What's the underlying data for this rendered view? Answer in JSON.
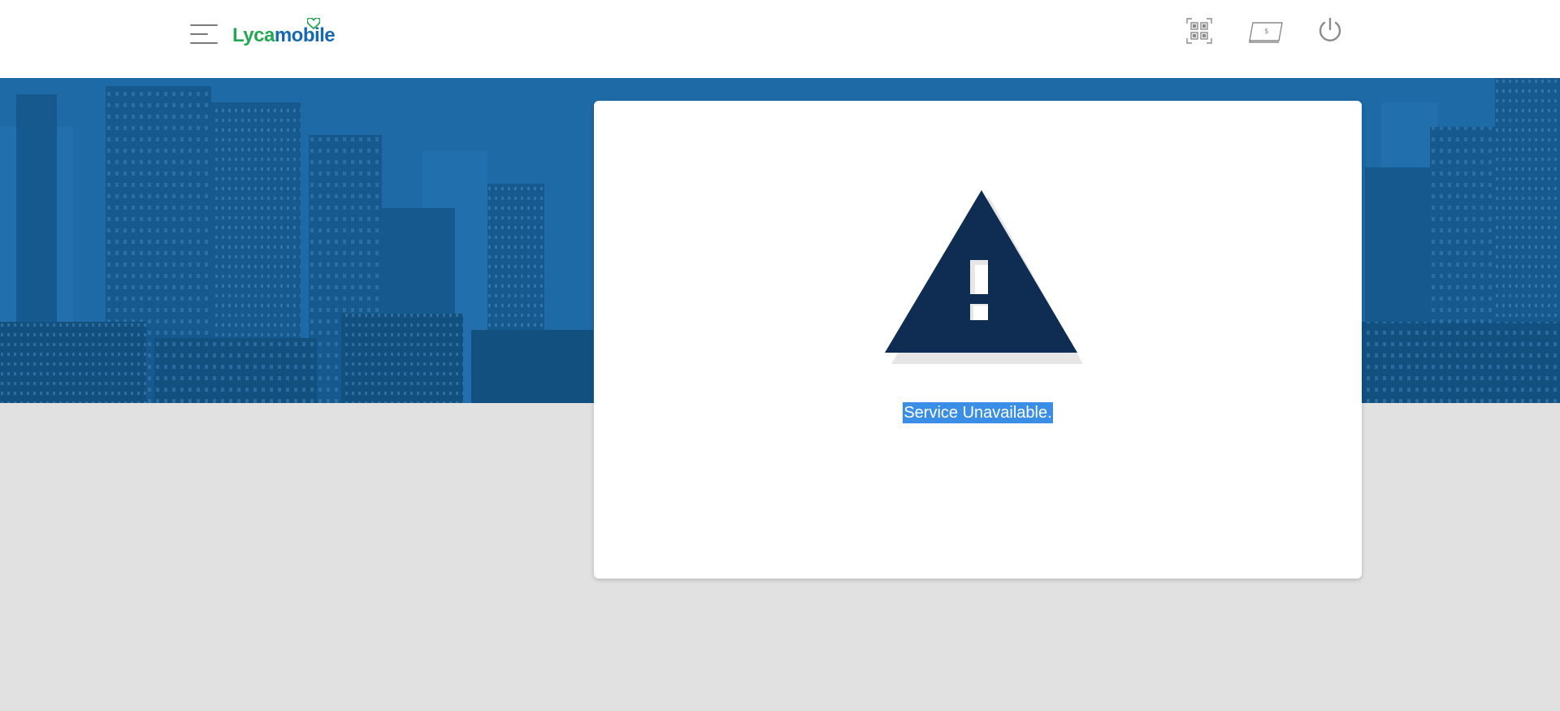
{
  "header": {
    "menu_icon": "hamburger-menu-icon",
    "logo": {
      "part1": "Lyca",
      "part2": "mobile"
    },
    "icons": [
      "qr-code-icon",
      "top-up-card-icon",
      "power-icon"
    ]
  },
  "colors": {
    "logo_green": "#22a851",
    "logo_blue": "#1569b1",
    "hero_blue": "#1d6aa6",
    "warning_navy": "#0f2d52",
    "page_bg": "#e1e1e1",
    "selection_blue": "#3a8ee6"
  },
  "card": {
    "icon": "warning-triangle-icon",
    "message": "Service Unavailable."
  }
}
